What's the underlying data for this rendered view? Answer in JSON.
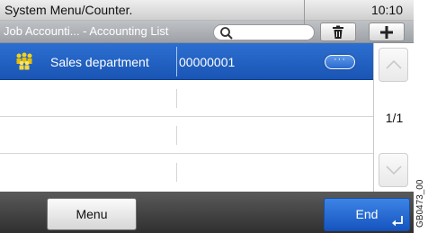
{
  "header": {
    "title": "System Menu/Counter.",
    "clock": "10:10",
    "breadcrumb": "Job Accounti... - Accounting List"
  },
  "toolbar": {
    "search_icon": "search-icon",
    "delete_icon": "trash-icon",
    "add_icon": "plus-icon"
  },
  "list": {
    "rows": [
      {
        "name": "Sales department",
        "id": "00000001",
        "selected": true,
        "detail_label": "···"
      },
      {
        "name": "",
        "id": ""
      },
      {
        "name": "",
        "id": ""
      },
      {
        "name": "",
        "id": ""
      }
    ]
  },
  "pager": {
    "indicator": "1/1",
    "up_icon": "chevron-up-icon",
    "down_icon": "chevron-down-icon"
  },
  "footer": {
    "menu_label": "Menu",
    "end_label": "End",
    "enter_icon": "enter-icon"
  },
  "side_code": "GB0473_00",
  "colors": {
    "selection": "#1f5fc4",
    "bottom_bar": "#3a3a3a",
    "end_button": "#2a6bd6"
  }
}
